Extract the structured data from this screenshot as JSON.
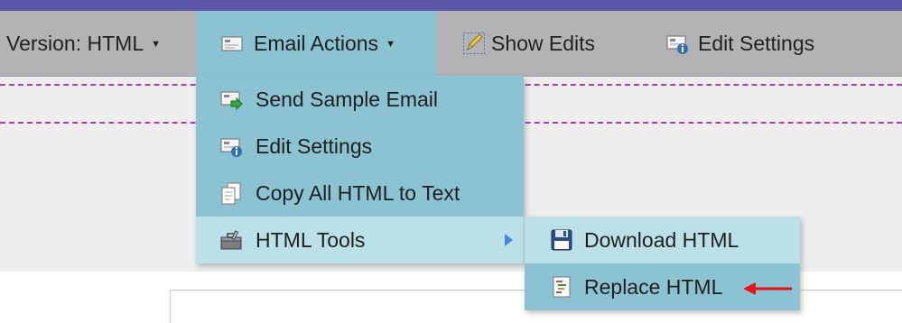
{
  "toolbar": {
    "version_label": "Version: HTML",
    "email_actions_label": "Email Actions",
    "show_edits_label": "Show Edits",
    "edit_settings_label": "Edit Settings"
  },
  "menu": {
    "items": [
      {
        "label": "Send Sample Email",
        "icon": "send-email-icon"
      },
      {
        "label": "Edit Settings",
        "icon": "email-settings-icon"
      },
      {
        "label": "Copy All HTML to Text",
        "icon": "copy-document-icon"
      },
      {
        "label": "HTML Tools",
        "icon": "toolbox-icon"
      }
    ]
  },
  "submenu": {
    "items": [
      {
        "label": "Download HTML",
        "icon": "floppy-disk-icon"
      },
      {
        "label": "Replace HTML",
        "icon": "html-file-icon"
      }
    ]
  },
  "colors": {
    "topbar": "#5b57a6",
    "toolbar": "#b3b3b6",
    "menu_bg": "#8cc3d2",
    "menu_active": "#bce0e8",
    "annotation_arrow": "#e0161b"
  }
}
